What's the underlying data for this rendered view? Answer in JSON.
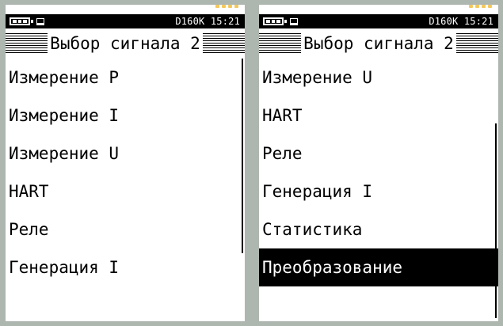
{
  "status_text": "D160K 15:21",
  "title": "Выбор сигнала 2",
  "icons": {
    "battery": "battery-icon",
    "plug": "plug-icon"
  },
  "left_screen": {
    "items": [
      "Измерение P",
      "Измерение I",
      "Измерение U",
      "HART",
      "Реле",
      "Генерация I"
    ]
  },
  "right_screen": {
    "items": [
      "Измерение U",
      "HART",
      "Реле",
      "Генерация I",
      "Статистика",
      "Преобразование"
    ],
    "selected": "Преобразование"
  }
}
